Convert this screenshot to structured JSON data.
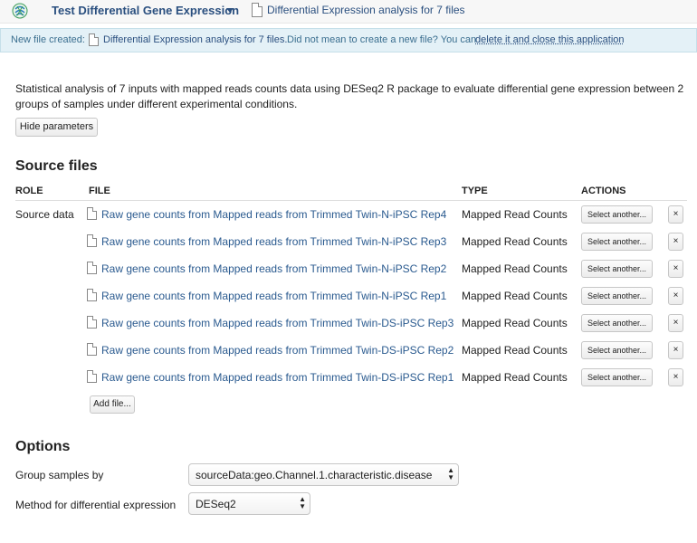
{
  "header": {
    "app_title": "Test Differential Gene Expression",
    "file_name": "Differential Expression analysis for 7 files"
  },
  "notice": {
    "prefix": "New file created:",
    "file_name": "Differential Expression analysis for 7 files.",
    "question": "Did not mean to create a new file? You can",
    "link": "delete it and close this application"
  },
  "description": "Statistical analysis of 7 inputs with mapped reads counts data using DESeq2 R package to evaluate differential gene expression between 2 groups of samples under different experimental conditions.",
  "hide_params_label": "Hide parameters",
  "source_files": {
    "title": "Source files",
    "columns": {
      "role": "ROLE",
      "file": "FILE",
      "type": "TYPE",
      "actions": "ACTIONS"
    },
    "role_label": "Source data",
    "select_label": "Select another...",
    "remove_label": "×",
    "add_label": "Add file...",
    "rows": [
      {
        "file": "Raw gene counts from Mapped reads from Trimmed Twin-N-iPSC Rep4",
        "type": "Mapped Read Counts"
      },
      {
        "file": "Raw gene counts from Mapped reads from Trimmed Twin-N-iPSC Rep3",
        "type": "Mapped Read Counts"
      },
      {
        "file": "Raw gene counts from Mapped reads from Trimmed Twin-N-iPSC Rep2",
        "type": "Mapped Read Counts"
      },
      {
        "file": "Raw gene counts from Mapped reads from Trimmed Twin-N-iPSC Rep1",
        "type": "Mapped Read Counts"
      },
      {
        "file": "Raw gene counts from Mapped reads from Trimmed Twin-DS-iPSC Rep3",
        "type": "Mapped Read Counts"
      },
      {
        "file": "Raw gene counts from Mapped reads from Trimmed Twin-DS-iPSC Rep2",
        "type": "Mapped Read Counts"
      },
      {
        "file": "Raw gene counts from Mapped reads from Trimmed Twin-DS-iPSC Rep1",
        "type": "Mapped Read Counts"
      }
    ]
  },
  "options": {
    "title": "Options",
    "group_label": "Group samples by",
    "group_value": "sourceData:geo.Channel.1.characteristic.disease",
    "method_label": "Method for differential expression",
    "method_value": "DESeq2"
  }
}
